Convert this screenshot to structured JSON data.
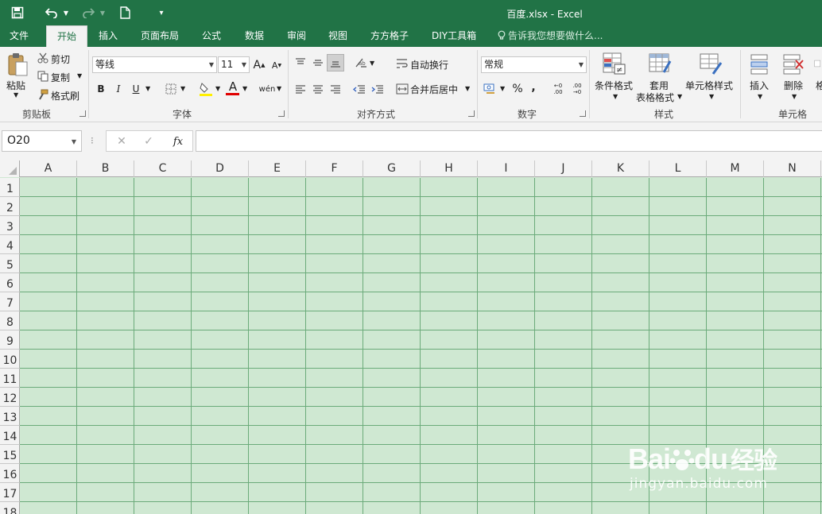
{
  "title_bar": {
    "title": "百度.xlsx - Excel",
    "accent": "#217346"
  },
  "tabs": [
    {
      "label": "文件",
      "active": false
    },
    {
      "label": "开始",
      "active": true
    },
    {
      "label": "插入",
      "active": false
    },
    {
      "label": "页面布局",
      "active": false
    },
    {
      "label": "公式",
      "active": false
    },
    {
      "label": "数据",
      "active": false
    },
    {
      "label": "审阅",
      "active": false
    },
    {
      "label": "视图",
      "active": false
    },
    {
      "label": "方方格子",
      "active": false
    },
    {
      "label": "DIY工具箱",
      "active": false
    }
  ],
  "tell_me": "告诉我您想要做什么...",
  "ribbon": {
    "clipboard": {
      "paste": "粘贴",
      "cut": "剪切",
      "copy": "复制",
      "format_painter": "格式刷",
      "label": "剪贴板"
    },
    "font": {
      "name": "等线",
      "size": "11",
      "bold": "B",
      "italic": "I",
      "underline": "U",
      "grow": "A",
      "shrink": "A",
      "font_color_glyph": "A",
      "phonetic": "wén",
      "label": "字体"
    },
    "alignment": {
      "wrap": "自动换行",
      "merge": "合并后居中",
      "label": "对齐方式"
    },
    "number": {
      "format": "常规",
      "percent": "%",
      "comma": ",",
      "inc_decimal": "←0 .00",
      "dec_decimal": ".00 →0",
      "label": "数字"
    },
    "styles": {
      "conditional": "条件格式",
      "table_format_line1": "套用",
      "table_format_line2": "表格格式",
      "cell_styles": "单元格样式",
      "label": "样式"
    },
    "cells": {
      "insert": "插入",
      "delete": "删除",
      "format": "格",
      "label": "单元格"
    }
  },
  "formula_bar": {
    "name_box": "O20",
    "fx": "fx",
    "cancel": "✕",
    "enter": "✓",
    "content": ""
  },
  "columns": [
    "A",
    "B",
    "C",
    "D",
    "E",
    "F",
    "G",
    "H",
    "I",
    "J",
    "K",
    "L",
    "M",
    "N"
  ],
  "rows": [
    "1",
    "2",
    "3",
    "4",
    "5",
    "6",
    "7",
    "8",
    "9",
    "10",
    "11",
    "12",
    "13",
    "14",
    "15",
    "16",
    "17",
    "18"
  ],
  "colors": {
    "cell_fill": "#cfe8d2",
    "gridline": "#6bab7a"
  },
  "watermark": {
    "brand": "Bai",
    "brand2": "du",
    "cn": "经验",
    "url": "jingyan.baidu.com"
  }
}
